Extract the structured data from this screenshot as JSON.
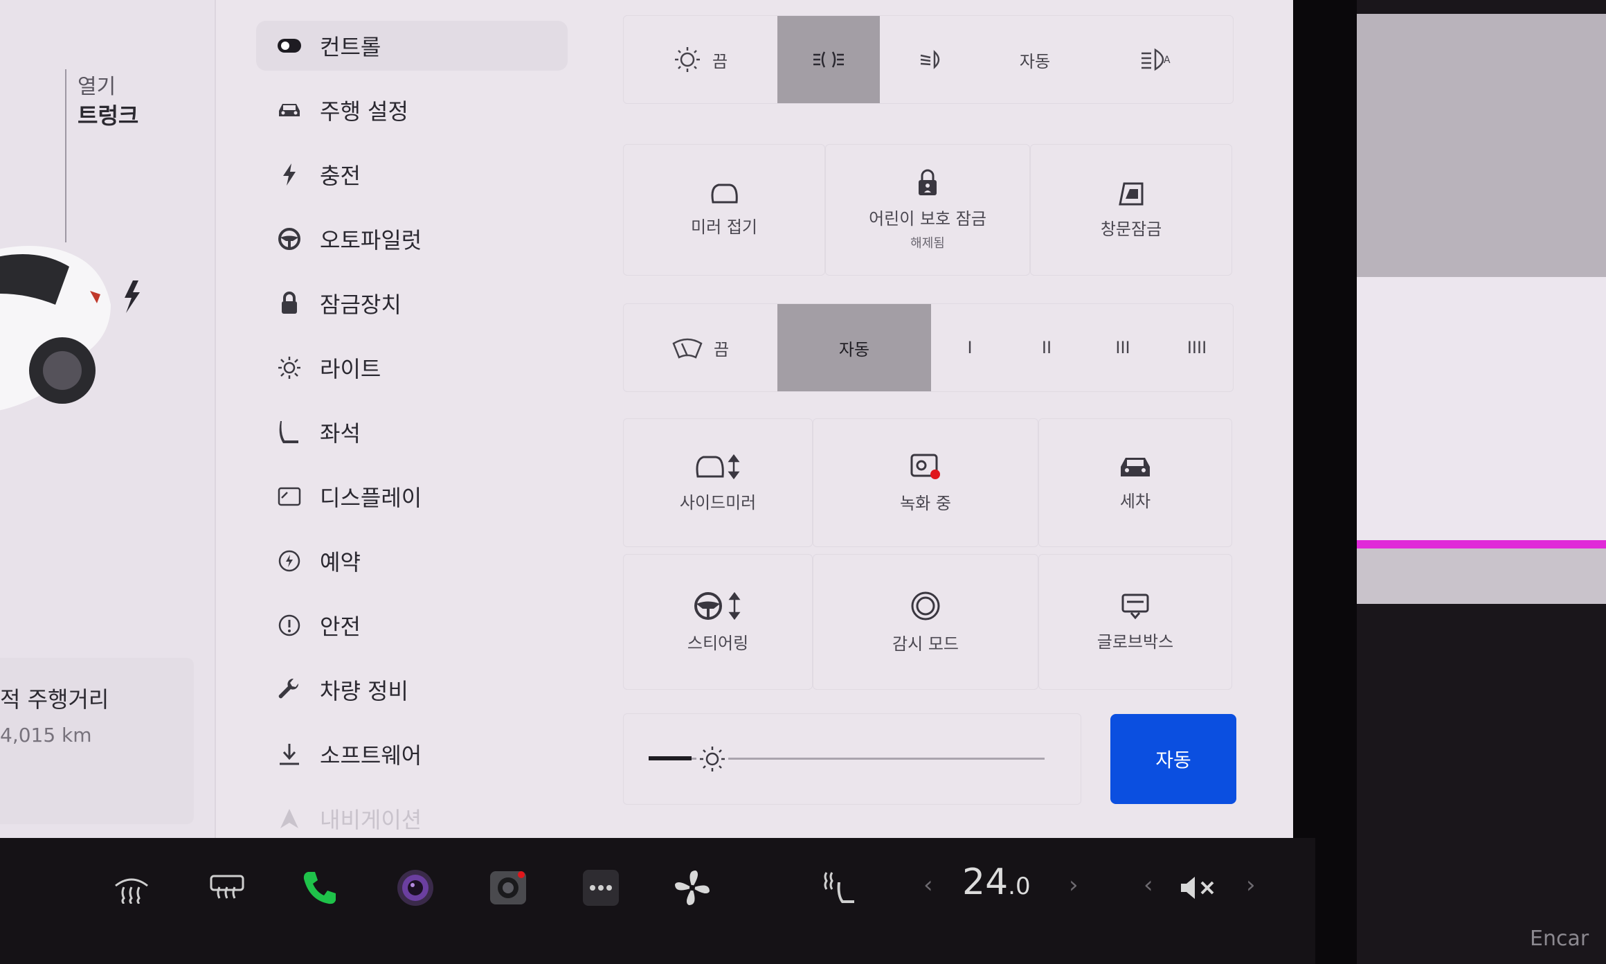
{
  "car_panel": {
    "open_label": "열기",
    "trunk_label": "트렁크",
    "odometer_label": "적 주행거리",
    "odometer_value": "4,015 km"
  },
  "menu": [
    {
      "label": "컨트롤",
      "icon": "toggle-icon",
      "active": true
    },
    {
      "label": "주행 설정",
      "icon": "car-icon"
    },
    {
      "label": "충전",
      "icon": "bolt-icon"
    },
    {
      "label": "오토파일럿",
      "icon": "steering-wheel-icon"
    },
    {
      "label": "잠금장치",
      "icon": "lock-icon"
    },
    {
      "label": "라이트",
      "icon": "sun-icon"
    },
    {
      "label": "좌석",
      "icon": "seat-icon"
    },
    {
      "label": "디스플레이",
      "icon": "display-icon"
    },
    {
      "label": "예약",
      "icon": "clock-icon"
    },
    {
      "label": "안전",
      "icon": "info-icon"
    },
    {
      "label": "차량 정비",
      "icon": "wrench-icon"
    },
    {
      "label": "소프트웨어",
      "icon": "download-icon"
    },
    {
      "label": "내비게이션",
      "icon": "navigation-icon"
    }
  ],
  "headlights": {
    "off_label": "끔",
    "auto_label": "자동",
    "selected": "parking-lights"
  },
  "controls_row1": {
    "mirror_fold": "미러 접기",
    "child_lock": "어린이 보호 잠금",
    "child_lock_status": "해제됨",
    "window_lock": "창문잠금"
  },
  "wipers": {
    "off_label": "끔",
    "auto_label": "자동",
    "speeds": [
      "I",
      "II",
      "III",
      "IIII"
    ],
    "selected": "auto"
  },
  "controls_row2": {
    "side_mirror": "사이드미러",
    "recording": "녹화 중",
    "car_wash": "세차"
  },
  "controls_row3": {
    "steering": "스티어링",
    "sentry_mode": "감시 모드",
    "glovebox": "글로브박스"
  },
  "brightness": {
    "level": 0.15,
    "auto_button": "자동"
  },
  "bottom_bar": {
    "temperature": "24",
    "temperature_decimal": ".0",
    "accent_green": "#1fc24a",
    "accent_purple": "#6b3fa0"
  },
  "watermark": "Encar",
  "colors": {
    "screen_bg": "#ebe5ec",
    "selected_segment": "#a39ea5",
    "auto_button": "#0b4fe0"
  }
}
